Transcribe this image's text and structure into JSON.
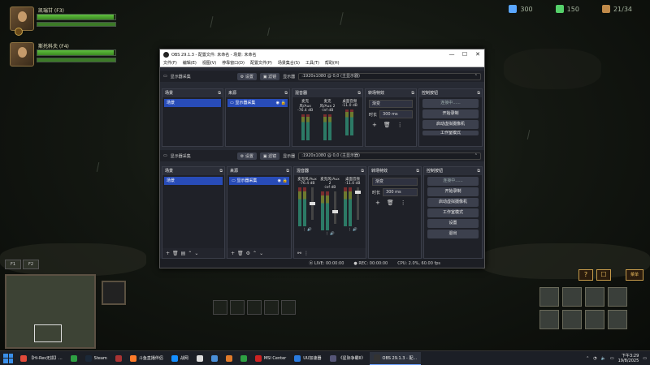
{
  "game": {
    "units": [
      {
        "name": "凯瑞甘 (F3)",
        "hp_fraction": 0.98
      },
      {
        "name": "斯托科夫 (F4)",
        "hp_fraction": 0.98
      }
    ],
    "resources": [
      {
        "icon": "minerals-icon",
        "value": "300",
        "color": "#5aa6ff"
      },
      {
        "icon": "vespene-icon",
        "value": "150",
        "color": "#55d06a"
      },
      {
        "icon": "supply-icon",
        "value": "21/34",
        "color": "#c08a4a"
      }
    ],
    "control_groups": [
      "F1",
      "F2"
    ],
    "hud_buttons": [
      "?",
      "☐",
      "菜单"
    ]
  },
  "obs": {
    "window_title": "OBS 29.1.3 - 配置文件: 未命名 - 场景: 未命名",
    "window_controls": [
      "—",
      "☐",
      "✕"
    ],
    "menu": [
      "文件(F)",
      "编辑(E)",
      "视图(V)",
      "停靠窗口(D)",
      "配置文件(P)",
      "场景集合(S)",
      "工具(T)",
      "帮助(H)"
    ],
    "preview_bars": [
      {
        "source_name": "显示器采集",
        "settings_label": "设置",
        "filters_label": "滤镜",
        "display_label": "显示器",
        "display_value": ":1920x1080 @ 0,0 (主显示器)"
      },
      {
        "source_name": "显示器采集",
        "settings_label": "设置",
        "filters_label": "滤镜",
        "display_label": "显示器",
        "display_value": ":1920x1080 @ 0,0 (主显示器)"
      }
    ],
    "docks": {
      "scenes": {
        "title": "场景",
        "items": [
          "场景"
        ]
      },
      "sources": {
        "title": "来源",
        "items": [
          "显示器采集"
        ]
      },
      "mixer": {
        "title": "混音器",
        "channels": [
          {
            "name": "麦克风/Aux",
            "level": "-76.4 dB",
            "fader": 0.5
          },
          {
            "name": "麦克风/Aux 2",
            "level": "-inf dB",
            "fader": 0.35
          },
          {
            "name": "桌面音频",
            "level": "-11.0 dB",
            "fader": 0.9
          }
        ]
      },
      "transitions": {
        "title": "转场特效",
        "type": "渐变",
        "duration_label": "时长",
        "duration": "300 ms"
      },
      "controls": {
        "title": "控制按钮",
        "buttons": [
          "连接中......",
          "开始录制",
          "启动虚拟摄像机",
          "工作室模式",
          "设置",
          "退出"
        ]
      }
    },
    "status": {
      "live": "LIVE: 00:00:00",
      "rec": "REC: 00:00:00",
      "cpu": "CPU: 2.0%, 60.00 fps"
    }
  },
  "taskbar": {
    "items": [
      {
        "label": "【Hi-Res无损】...",
        "color": "#e24a3a"
      },
      {
        "label": "",
        "color": "#2ea043"
      },
      {
        "label": "Steam",
        "color": "#1b2838"
      },
      {
        "label": "",
        "color": "#a33"
      },
      {
        "label": "斗鱼直播伴侣",
        "color": "#ff7b2a"
      },
      {
        "label": "战网",
        "color": "#148eff"
      },
      {
        "label": "",
        "color": "#ddd"
      },
      {
        "label": "",
        "color": "#4a8fd8"
      },
      {
        "label": "",
        "color": "#e07a2a"
      },
      {
        "label": "",
        "color": "#2ea043"
      },
      {
        "label": "MSI Center",
        "color": "#c22"
      },
      {
        "label": "UU加速器",
        "color": "#2a7be0"
      },
      {
        "label": "《星际争霸II》",
        "color": "#557"
      },
      {
        "label": "OBS 29.1.3 - 配...",
        "color": "#333"
      }
    ],
    "time": "下午3:29",
    "date": "19/8/2025"
  }
}
